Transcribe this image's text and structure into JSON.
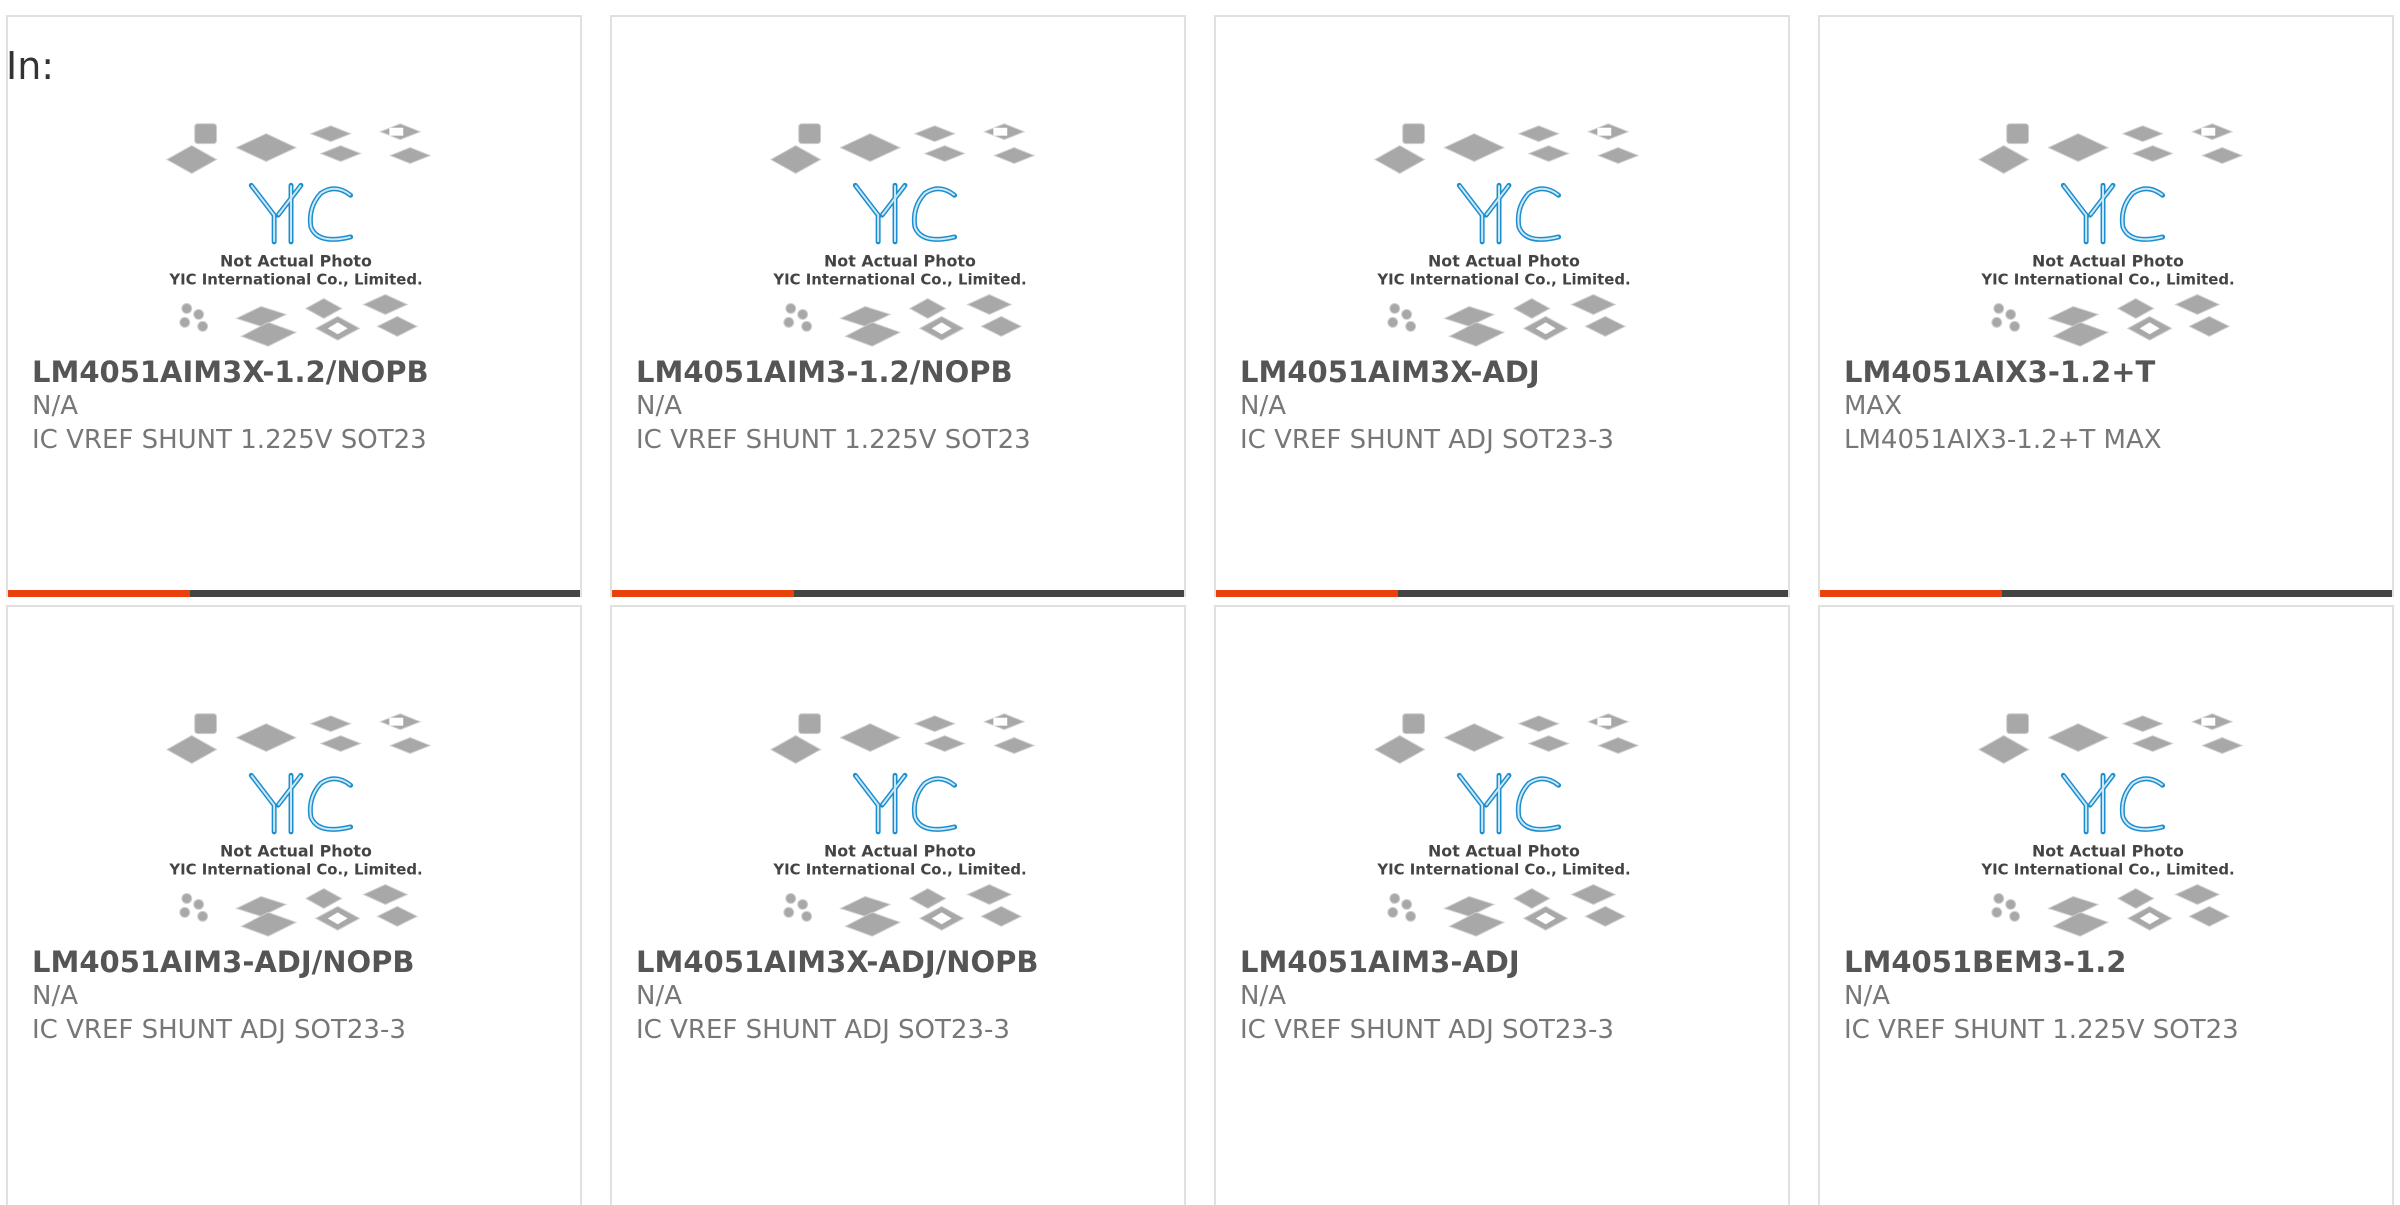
{
  "header": {
    "label": "In:"
  },
  "placeholder": {
    "caption1": "Not Actual Photo",
    "caption2": "YIC International Co., Limited.",
    "logo": "YIC"
  },
  "colors": {
    "accent": "#e8410c",
    "bar": "#444444",
    "logo_blue": "#1a8fd0"
  },
  "cards": [
    {
      "part": "LM4051AIM3X-1.2/NOPB",
      "mfr": "N/A",
      "desc": "IC VREF SHUNT 1.225V SOT23"
    },
    {
      "part": "LM4051AIM3-1.2/NOPB",
      "mfr": "N/A",
      "desc": "IC VREF SHUNT 1.225V SOT23"
    },
    {
      "part": "LM4051AIM3X-ADJ",
      "mfr": "N/A",
      "desc": "IC VREF SHUNT ADJ SOT23-3"
    },
    {
      "part": "LM4051AIX3-1.2+T",
      "mfr": "MAX",
      "desc": "LM4051AIX3-1.2+T MAX"
    },
    {
      "part": "LM4051AIM3-ADJ/NOPB",
      "mfr": "N/A",
      "desc": "IC VREF SHUNT ADJ SOT23-3"
    },
    {
      "part": "LM4051AIM3X-ADJ/NOPB",
      "mfr": "N/A",
      "desc": "IC VREF SHUNT ADJ SOT23-3"
    },
    {
      "part": "LM4051AIM3-ADJ",
      "mfr": "N/A",
      "desc": "IC VREF SHUNT ADJ SOT23-3"
    },
    {
      "part": "LM4051BEM3-1.2",
      "mfr": "N/A",
      "desc": "IC VREF SHUNT 1.225V SOT23"
    }
  ]
}
